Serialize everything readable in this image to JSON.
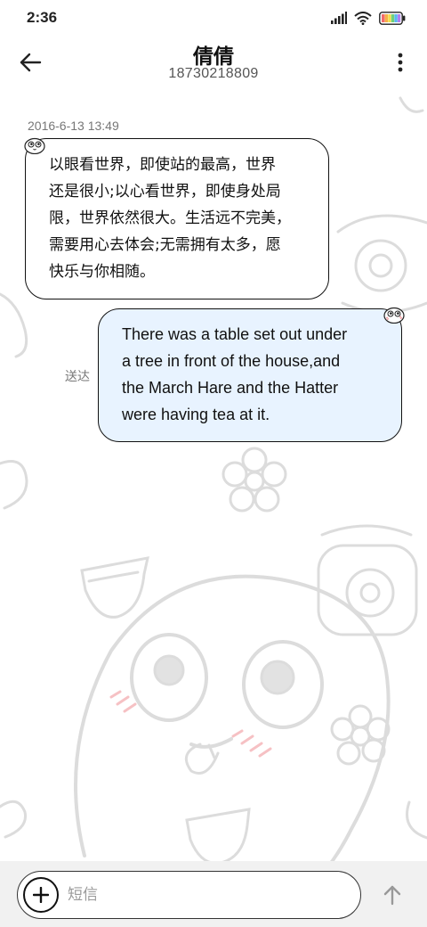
{
  "status_bar": {
    "time": "2:36",
    "icons": [
      "signal-icon",
      "wifi-icon",
      "battery-icon"
    ]
  },
  "header": {
    "contact_name": "倩倩",
    "contact_number": "18730218809",
    "back_icon": "back-arrow-icon",
    "more_icon": "more-vertical-icon"
  },
  "conversation": {
    "timestamp": "2016-6-13 13:49",
    "messages": [
      {
        "direction": "incoming",
        "lines": [
          "以眼看世界，即使站的最高，世界",
          "还是很小;以心看世界，即使身处局",
          "限，世界依然很大。生活远不完美，",
          "需要用心去体会;无需拥有太多，愿",
          "快乐与你相随。"
        ]
      },
      {
        "direction": "outgoing",
        "status": "送达",
        "lines": [
          "There was a table set out under",
          "a tree in front of the house,and",
          "the March Hare and the Hatter",
          "were having tea at it."
        ]
      }
    ]
  },
  "composer": {
    "placeholder": "短信",
    "value": "",
    "attach_icon": "plus-circle-icon",
    "send_icon": "send-arrow-icon"
  },
  "colors": {
    "outgoing_bubble": "#e8f3ff",
    "incoming_bubble": "#ffffff",
    "composer_bg": "#f1f1f1",
    "doodle_stroke": "#d9d9d9",
    "blush": "#f4a9ad"
  }
}
